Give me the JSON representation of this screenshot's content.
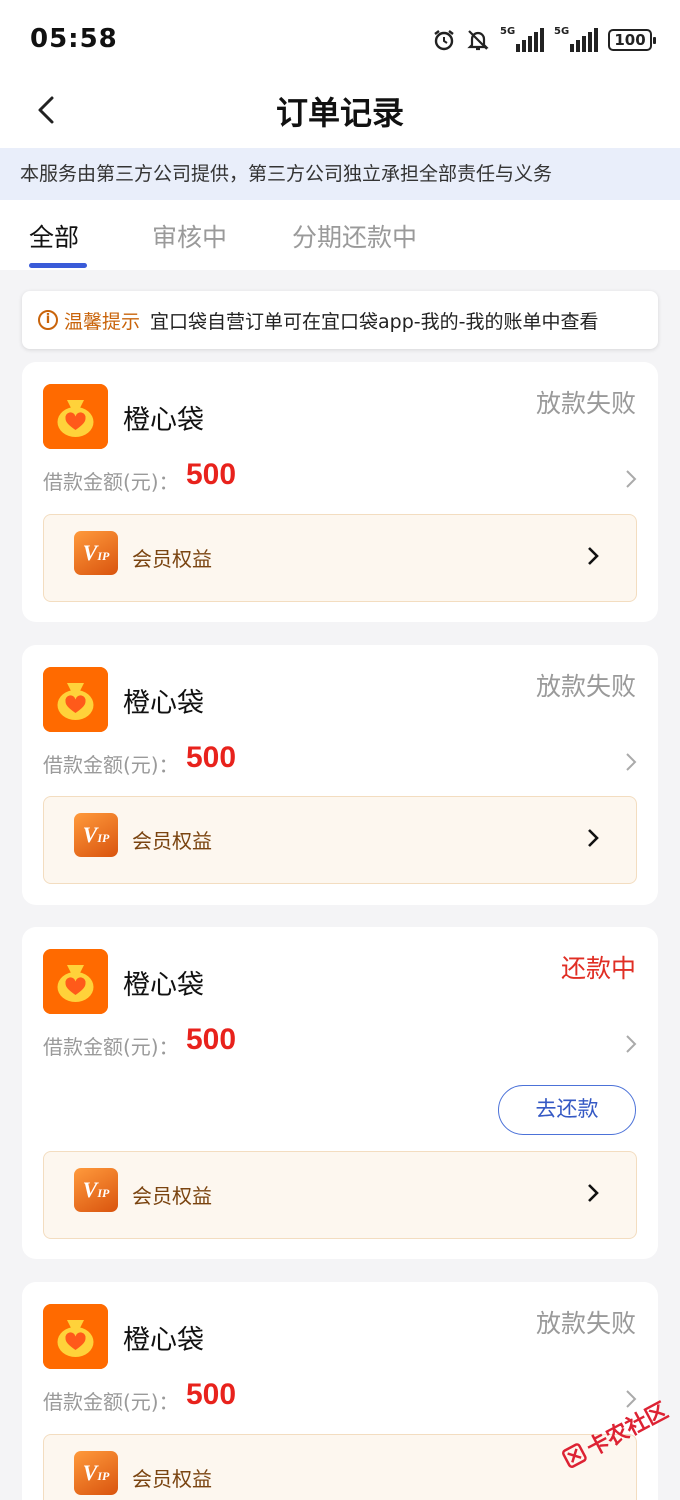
{
  "status_bar": {
    "time": "05:58",
    "signal_label_1": "5G",
    "signal_label_2": "5G",
    "battery": "100",
    "icons": [
      "alarm-icon",
      "bell-off-icon",
      "signal-icon",
      "signal-icon",
      "battery-icon"
    ]
  },
  "header": {
    "title": "订单记录",
    "back_icon": "chevron-left-icon"
  },
  "notice": "本服务由第三方公司提供，第三方公司独立承担全部责任与义务",
  "tabs": [
    {
      "label": "全部",
      "active": true
    },
    {
      "label": "审核中",
      "active": false
    },
    {
      "label": "分期还款中",
      "active": false
    }
  ],
  "tip": {
    "icon": "info-icon",
    "label": "温馨提示",
    "text": "宜口袋自营订单可在宜口袋app-我的-我的账单中查看"
  },
  "orders": [
    {
      "lender": "橙心袋",
      "status": "放款失败",
      "amount_label": "借款金额(元)：",
      "amount": "500",
      "vip_label": "会员权益"
    },
    {
      "lender": "橙心袋",
      "status": "放款失败",
      "amount_label": "借款金额(元)：",
      "amount": "500",
      "vip_label": "会员权益"
    },
    {
      "lender": "橙心袋",
      "status": "还款中",
      "amount_label": "借款金额(元)：",
      "amount": "500",
      "action_label": "去还款",
      "vip_label": "会员权益"
    },
    {
      "lender": "橙心袋",
      "status": "放款失败",
      "amount_label": "借款金额(元)：",
      "amount": "500",
      "vip_label": "会员权益"
    }
  ],
  "vip_icon_text": "VIP",
  "watermark": "卡农社区",
  "colors": {
    "accent_blue": "#3a5bd8",
    "amount_red": "#e8221c",
    "status_red": "#e02e24",
    "logo_orange": "#ff6a00",
    "tip_orange": "#c9640b"
  }
}
